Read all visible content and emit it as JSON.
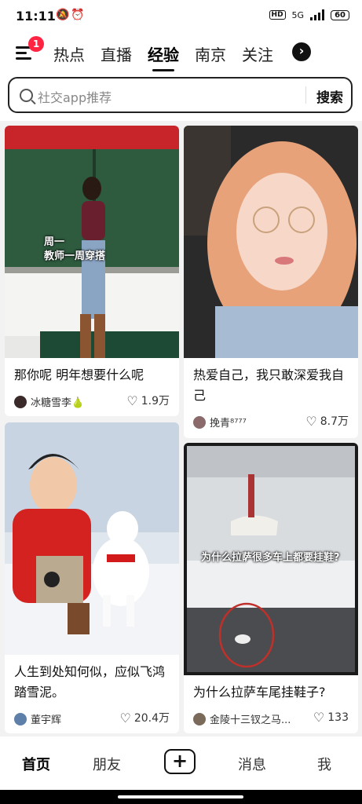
{
  "status": {
    "time": "11:11",
    "left_icons": "🔕⏰",
    "hd": "HD",
    "net": "5G",
    "battery": "60"
  },
  "topnav": {
    "badge": "1",
    "tabs": [
      {
        "label": "热点",
        "active": false
      },
      {
        "label": "直播",
        "active": false
      },
      {
        "label": "经验",
        "active": true
      },
      {
        "label": "南京",
        "active": false
      },
      {
        "label": "关注",
        "active": false
      }
    ],
    "more_icon": "chevron-right-icon"
  },
  "search": {
    "placeholder": "社交app推荐",
    "button": "搜索"
  },
  "cards": [
    {
      "title": "那你呢 明年想要什么呢",
      "author": "冰糖雪李🍐",
      "likes": "1.9万",
      "overlay": "周一\n教师一周穿搭"
    },
    {
      "title": "热爱自己，我只敢深爱我自己",
      "author": "挽青⁸⁷⁷⁷",
      "likes": "8.7万"
    },
    {
      "title": "人生到处知何似，应似飞鸿踏雪泥。",
      "author": "董宇辉",
      "likes": "20.4万"
    },
    {
      "title": "为什么拉萨车尾挂鞋子?",
      "author": "金陵十三钗之马...",
      "likes": "133",
      "overlay": "为什么拉萨很多车上都要挂鞋?"
    }
  ],
  "bottomnav": {
    "home": "首页",
    "friends": "朋友",
    "messages": "消息",
    "me": "我"
  },
  "colors": {
    "badge": "#ff2442",
    "active_text": "#000000",
    "background": "#f2f2f2"
  }
}
